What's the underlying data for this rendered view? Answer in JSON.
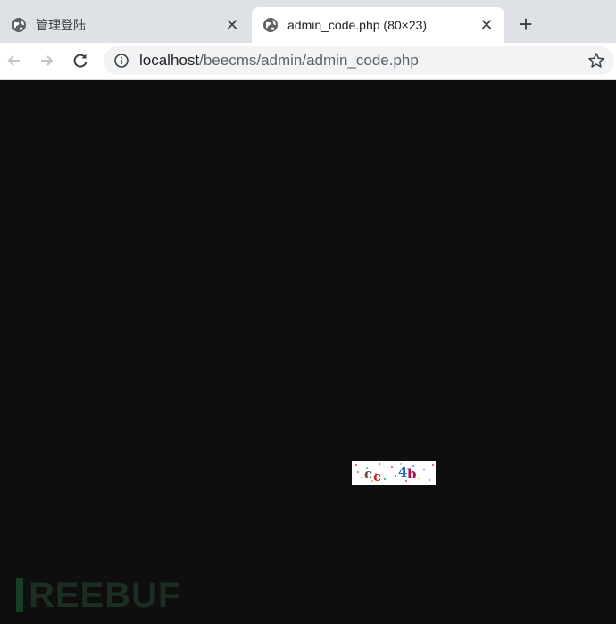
{
  "tabs": [
    {
      "title": "管理登陆",
      "favicon": "globe-icon",
      "active": false
    },
    {
      "title": "admin_code.php (80×23)",
      "favicon": "globe-icon",
      "active": true
    }
  ],
  "tab_close_glyph": "✕",
  "new_tab_glyph": "+",
  "toolbar": {
    "back": "arrow-left-icon",
    "forward": "arrow-right-icon",
    "reload": "reload-icon",
    "info": "info-icon",
    "bookmark": "star-icon"
  },
  "address_bar": {
    "host": "localhost",
    "path": "/beecms/admin/admin_code.php"
  },
  "content": {
    "background": "#0e0e0e",
    "image": "captcha-image",
    "captcha_chars": [
      "c",
      "c",
      "4",
      "b"
    ]
  },
  "watermark": {
    "text": "REEBUF",
    "color": "#1c2e22"
  }
}
